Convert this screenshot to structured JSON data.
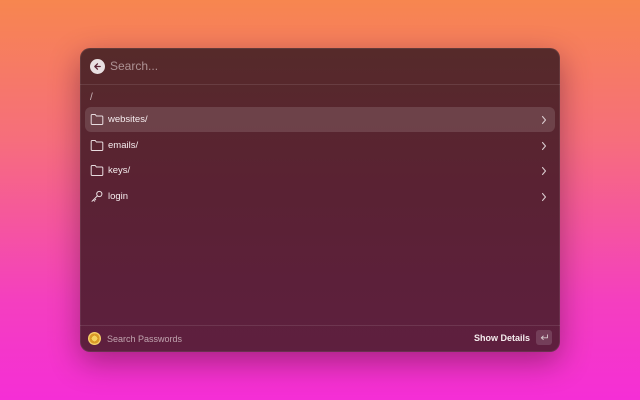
{
  "search": {
    "placeholder": "Search...",
    "value": ""
  },
  "breadcrumb": "/",
  "items": [
    {
      "label": "websites/",
      "icon": "folder-icon",
      "selected": true
    },
    {
      "label": "emails/",
      "icon": "folder-icon",
      "selected": false
    },
    {
      "label": "keys/",
      "icon": "folder-icon",
      "selected": false
    },
    {
      "label": "login",
      "icon": "key-icon",
      "selected": false
    }
  ],
  "footer": {
    "title": "Search Passwords",
    "action_label": "Show Details",
    "action_shortcut_icon": "return-key-icon"
  },
  "colors": {
    "window_bg": "#5a2233",
    "selected_row": "#6b3b45",
    "text": "#f2e6e8"
  }
}
